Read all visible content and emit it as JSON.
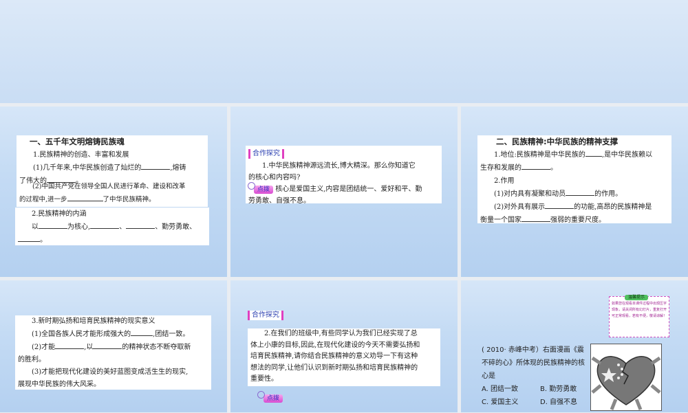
{
  "slide1": {
    "heading": "一、五千年文明熔铸民族魂",
    "l1": "1.民族精神的创造、丰富和发展",
    "l2a": "(1)几千年来,中华民族创造了灿烂的",
    "l2b": ",熔铸",
    "l3a": "了伟大的",
    "l3b": "。",
    "l4": "(2)中国共产党在领导全国人民进行革命、建设和改革",
    "l5a": "的过程中,进一步",
    "l5b": "了中华民族精神。",
    "l6": "2.民族精神的内涵",
    "l7a": "以",
    "l7b": "为核心,",
    "l7c": "、",
    "l7d": "、勤劳勇敢、",
    "l8": "。"
  },
  "slide2": {
    "tag": "合作探究",
    "q1": "1.中华民族精神源远流长,博大精深。那么你知道它",
    "q2": "的核心和内容吗?",
    "hint": "点拨",
    "a1": "核心是爱国主义,内容是团结统一、爱好和平、勤",
    "a2": "劳勇敢、自强不息。"
  },
  "slide3": {
    "heading": "二、民族精神:中华民族的精神支撑",
    "l1a": "1.地位:民族精神是中华民族的",
    "l1b": ",是中华民族赖以",
    "l2a": "生存和发展的",
    "l2b": "。",
    "l3": "2.作用",
    "l4a": "(1)对内具有凝聚和动员",
    "l4b": "的作用。",
    "l5a": "(2)对外具有展示",
    "l5b": "的功能,高昂的民族精神是",
    "l6a": "衡量一个国家",
    "l6b": "强弱的重要尺度。"
  },
  "slide4": {
    "l1": "3.新时期弘扬和培育民族精神的现实意义",
    "l2a": "(1)全国各族人民才能形成强大的",
    "l2b": ",团结一致。",
    "l3a": "(2)才能",
    "l3b": ",以",
    "l3c": "的精神状态不断夺取新",
    "l4": "的胜利。",
    "l5": "(3)才能把现代化建设的美好蓝图变成活生生的现实,",
    "l6": "展现中华民族的伟大风采。"
  },
  "slide5": {
    "tag": "合作探究",
    "p1": "2.在我们的班级中,有些同学认为我们已经实现了总",
    "p2": "体上小康的目标,因此,在现代化建设的今天不需要弘扬和",
    "p3": "培育民族精神,请你结合民族精神的意义劝导一下有这种",
    "p4": "想法的同学,让他们认识到新时期弘扬和培育民族精神的",
    "p5": "重要性。",
    "hint": "点拨"
  },
  "slide6": {
    "tip_title": "温馨提示",
    "tip_text": "如果您在观看本课件过程中出现压字现象，请关闭所有幻灯片，重复打开可正常观看，若有不便，敬请谅解！",
    "q1": "( 2010· 赤峰中考）右面漫画《震",
    "q2": "不碎的心》所体现的民族精神的核",
    "q3": "心是",
    "opts": [
      "A. 团结一致",
      "B. 勤劳勇敢",
      "C. 爱国主义",
      "D. 自强不息"
    ]
  }
}
